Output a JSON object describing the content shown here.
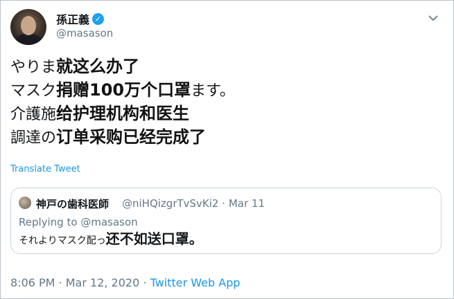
{
  "author": {
    "name": "孫正義",
    "handle": "@masason",
    "verified": true
  },
  "tweet_lines": [
    {
      "original": "やりま",
      "overlay": "就这么办了"
    },
    {
      "original": "マスク",
      "overlay": "捐赠100万个口罩",
      "tail": "ます。"
    },
    {
      "original": "介護施",
      "overlay": "给护理机构和医生"
    },
    {
      "original": "調達の",
      "overlay": "订单采购已经完成了"
    }
  ],
  "translate_label": "Translate Tweet",
  "quote": {
    "name": "神戸の歯科医師",
    "handle": "@niHQizgrTvSvKi2",
    "separator": "·",
    "date": "Mar 11",
    "replying_to": "Replying to @masason",
    "text_original": "それよりマスク配っ",
    "text_overlay": "还不如送口罩。"
  },
  "meta": {
    "time": "8:06 PM",
    "separator1": "·",
    "date": "Mar 12, 2020",
    "separator2": "·",
    "source": "Twitter Web App"
  },
  "colors": {
    "link": "#1b95e0",
    "muted": "#657786",
    "verified": "#1da1f2"
  },
  "icons": [
    "verified-badge-icon",
    "chevron-down-icon"
  ]
}
